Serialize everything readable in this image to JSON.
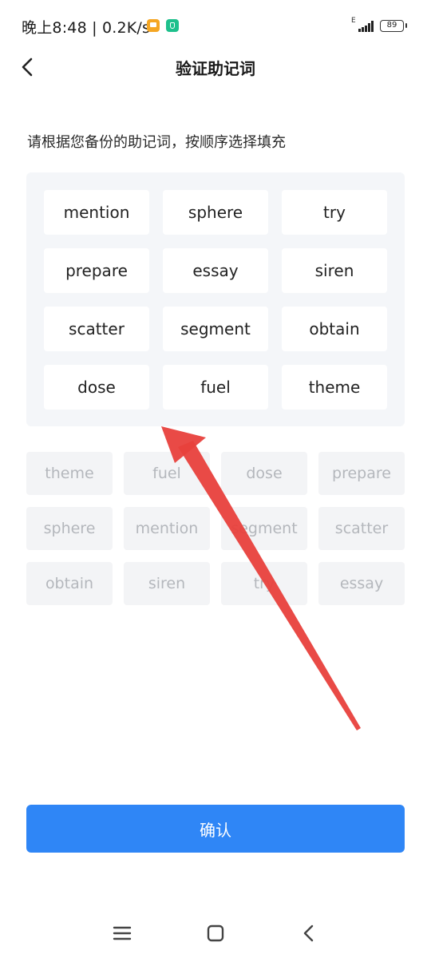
{
  "status_bar": {
    "time": "晚上8:48 | 0.2K/s",
    "network_type": "E",
    "battery": "89",
    "icons": [
      "message-notification-icon",
      "security-shield-icon",
      "signal-icon",
      "battery-icon"
    ]
  },
  "nav": {
    "title": "验证助记词",
    "back_icon": "chevron-left-icon"
  },
  "instruction": "请根据您备份的助记词，按顺序选择填充",
  "selected_words": [
    "mention",
    "sphere",
    "try",
    "prepare",
    "essay",
    "siren",
    "scatter",
    "segment",
    "obtain",
    "dose",
    "fuel",
    "theme"
  ],
  "word_bank": [
    "theme",
    "fuel",
    "dose",
    "prepare",
    "sphere",
    "mention",
    "segment",
    "scatter",
    "obtain",
    "siren",
    "try",
    "essay"
  ],
  "confirm_label": "确认",
  "system_nav": {
    "icons": [
      "menu-icon",
      "home-icon",
      "back-icon"
    ]
  },
  "colors": {
    "primary": "#2f86f6",
    "panel_bg": "#f4f6f9",
    "bank_text": "#b4b7bc",
    "annotation_arrow": "#e8403c"
  }
}
